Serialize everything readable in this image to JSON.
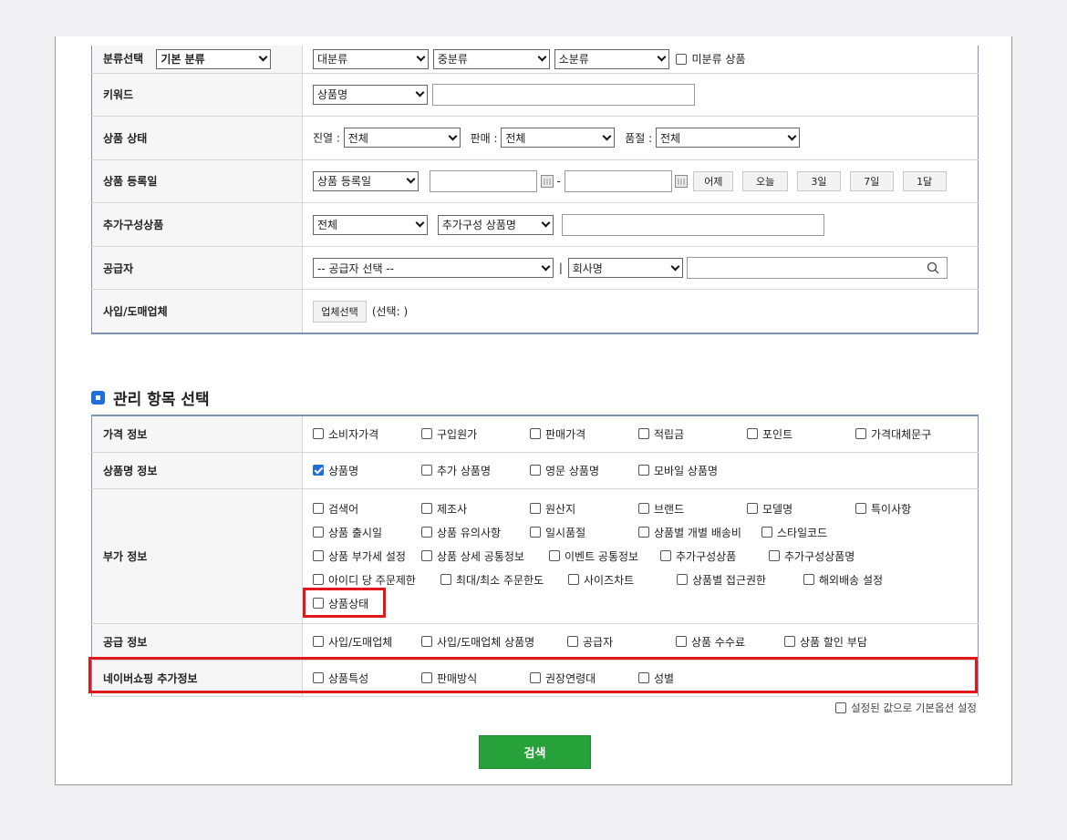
{
  "search": {
    "category": {
      "label": "분류선택",
      "base": "기본 분류",
      "large": "대분류",
      "medium": "중분류",
      "small": "소분류",
      "uncategorized": "미분류 상품"
    },
    "keyword": {
      "label": "키워드",
      "type": "상품명",
      "value": ""
    },
    "status": {
      "label": "상품 상태",
      "display_label": "진열 :",
      "display_value": "전체",
      "sale_label": "판매 :",
      "sale_value": "전체",
      "soldout_label": "품절 :",
      "soldout_value": "전체"
    },
    "regdate": {
      "label": "상품 등록일",
      "type": "상품 등록일",
      "sep": "-",
      "quick": [
        "어제",
        "오늘",
        "3일",
        "7일",
        "1달"
      ]
    },
    "addon": {
      "label": "추가구성상품",
      "type": "전체",
      "name_type": "추가구성 상품명"
    },
    "supplier": {
      "label": "공급자",
      "select": "-- 공급자 선택 --",
      "divider": "|",
      "field": "회사명",
      "search_icon": "search-icon"
    },
    "wholesale": {
      "label": "사입/도매업체",
      "button": "업체선택",
      "status": "(선택: )"
    }
  },
  "mgmt": {
    "title": "관리 항목 선택",
    "price": {
      "label": "가격 정보",
      "items": [
        "소비자가격",
        "구입원가",
        "판매가격",
        "적립금",
        "포인트",
        "가격대체문구"
      ]
    },
    "name": {
      "label": "상품명 정보",
      "items": [
        "상품명",
        "추가 상품명",
        "영문 상품명",
        "모바일 상품명"
      ]
    },
    "extra": {
      "label": "부가 정보",
      "row1": [
        "검색어",
        "제조사",
        "원산지",
        "브랜드",
        "모델명",
        "특이사항"
      ],
      "row2": [
        "상품 출시일",
        "상품 유의사항",
        "일시품절",
        "상품별 개별 배송비",
        "스타일코드"
      ],
      "row3": [
        "상품 부가세 설정",
        "상품 상세 공통정보",
        "이벤트 공통정보",
        "추가구성상품",
        "추가구성상품명"
      ],
      "row4": [
        "아이디 당 주문제한",
        "최대/최소 주문한도",
        "사이즈차트",
        "상품별 접근권한",
        "해외배송 설정"
      ],
      "row5": [
        "상품상태"
      ]
    },
    "supply": {
      "label": "공급 정보",
      "items": [
        "사입/도매업체",
        "사입/도매업체 상품명",
        "공급자",
        "상품 수수료",
        "상품 할인 부담"
      ]
    },
    "naver": {
      "label": "네이버쇼핑 추가정보",
      "items": [
        "상품특성",
        "판매방식",
        "권장연령대",
        "성별"
      ]
    }
  },
  "default_option": "설정된 값으로 기본옵션 설정",
  "search_button": "검색",
  "colors": {
    "accent": "#1e6fd9",
    "highlight": "#e0181a",
    "button": "#27a23a"
  }
}
